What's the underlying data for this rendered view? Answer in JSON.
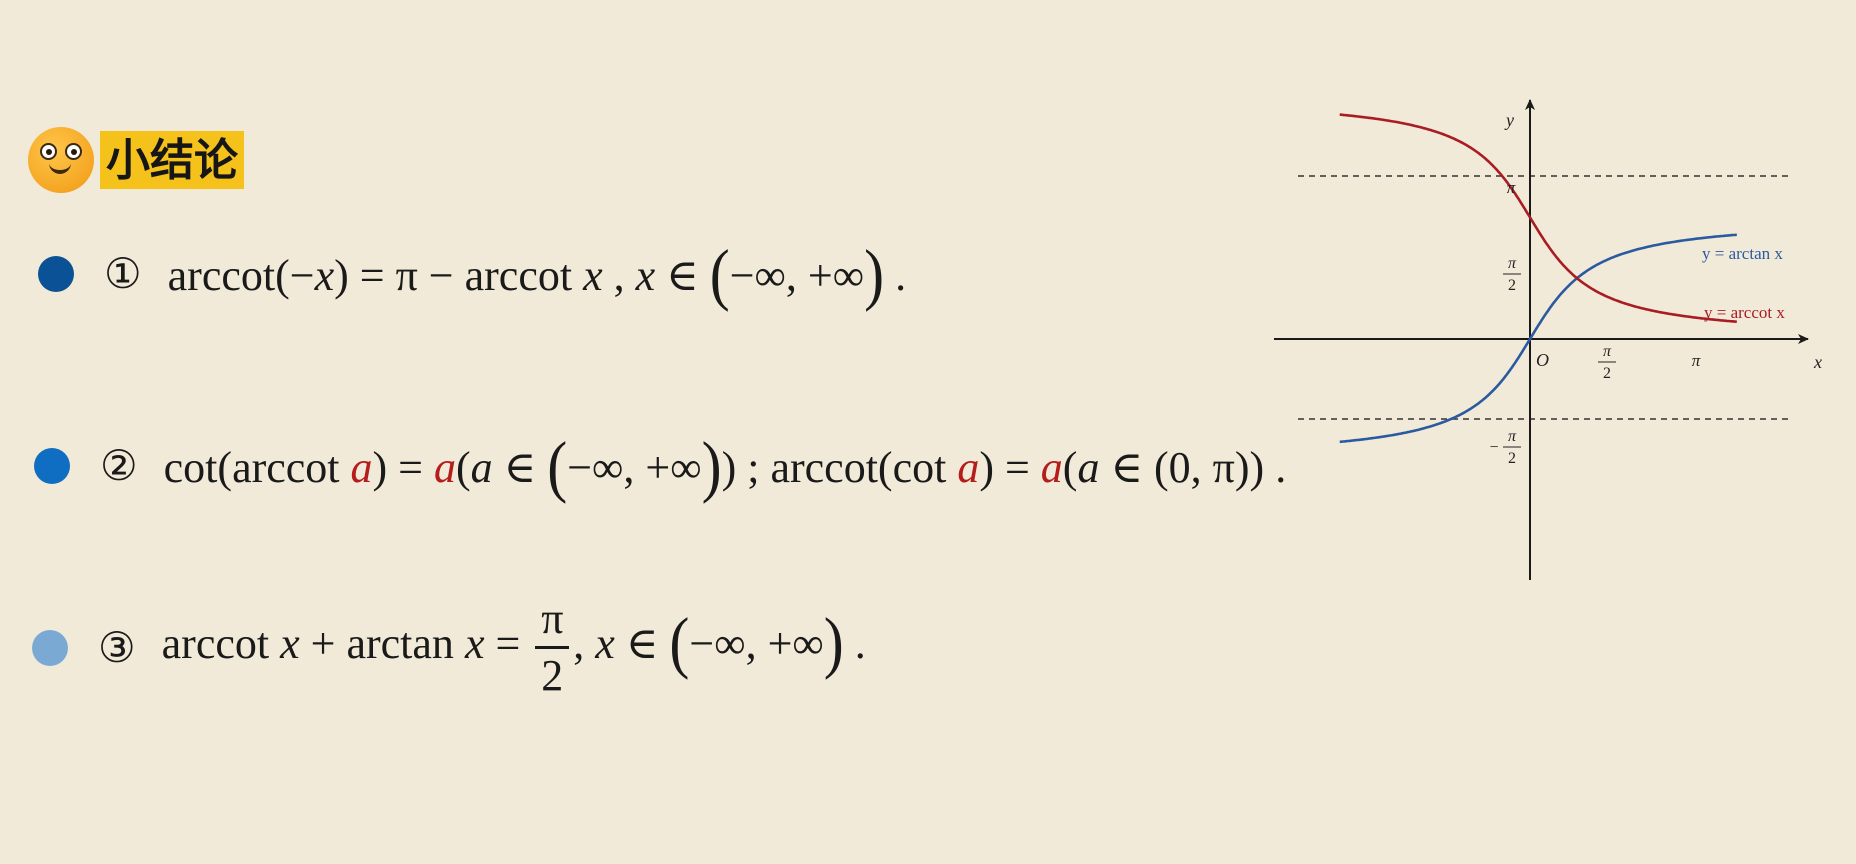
{
  "heading": {
    "title": "小结论"
  },
  "conclusions": [
    {
      "marker": "①",
      "color": "#0a5196",
      "parts": {
        "a": "arccot(−",
        "b": "x",
        "c": ") = π − arccot ",
        "d": "x",
        "e": " ,   ",
        "f": "x",
        "g": " ∈ ",
        "h": "(",
        "i": "−∞, +∞",
        "j": ")",
        "k": " ."
      }
    },
    {
      "marker": "②",
      "color": "#0f6ec2",
      "parts": {
        "a": "cot(arccot ",
        "b": "a",
        "c": ") = ",
        "d": "a",
        "e": "(",
        "f": "a",
        "g": " ∈ ",
        "h": "(",
        "i": "−∞, +∞",
        "j": ")",
        "k": ") ;   arccot(cot ",
        "l": "a",
        "m": ") = ",
        "n": "a",
        "o": "(",
        "p": "a",
        "q": " ∈ (0, π)) ."
      }
    },
    {
      "marker": "③",
      "color": "#7aaad4",
      "parts": {
        "a": "arccot ",
        "b": "x",
        "c": " + arctan ",
        "d": "x",
        "e": " = ",
        "num": "π",
        "den": "2",
        "f": ", ",
        "g": "x",
        "h": " ∈ ",
        "i": "(",
        "j": "−∞, +∞",
        "k": ")",
        "l": " ."
      }
    }
  ],
  "graph": {
    "axis_x_label": "x",
    "axis_y_label": "y",
    "origin_label": "O",
    "tick_x_pi_half_num": "π",
    "tick_x_pi_half_den": "2",
    "tick_x_pi": "π",
    "tick_y_pi": "π",
    "tick_y_pi_half_num": "π",
    "tick_y_pi_half_den": "2",
    "tick_y_neg_sign": "−",
    "tick_y_neg_num": "π",
    "tick_y_neg_den": "2",
    "arctan_label": "y = arctan x",
    "arccot_label": "y = arccot x",
    "arctan_color": "#2a5aa0",
    "arccot_color": "#a81c24"
  }
}
